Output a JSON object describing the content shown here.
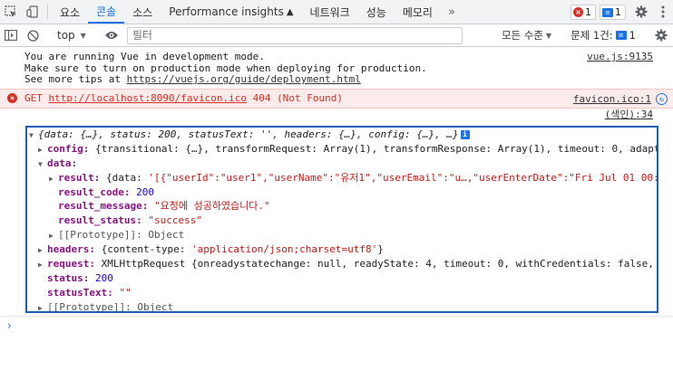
{
  "tabbar": {
    "tabs": [
      {
        "label": "요소"
      },
      {
        "label": "콘솔"
      },
      {
        "label": "소스"
      },
      {
        "label": "Performance insights"
      },
      {
        "label": "네트워크"
      },
      {
        "label": "성능"
      },
      {
        "label": "메모리"
      }
    ],
    "more": "»",
    "error_count": "1",
    "message_count": "1"
  },
  "filterbar": {
    "context": "top",
    "filter_placeholder": "필터",
    "levels": "모든 수준",
    "issues_label": "문제 1건:",
    "issues_count": "1"
  },
  "console": {
    "vue_message": [
      "You are running Vue in development mode.",
      "Make sure to turn on production mode when deploying for production.",
      "See more tips at "
    ],
    "vue_link": "https://vuejs.org/guide/deployment.html",
    "vue_source": "vue.js:9135",
    "error_method": "GET",
    "error_url": "http://localhost:8090/favicon.ico",
    "error_status": "404 (Not Found)",
    "error_source": "favicon.ico:1",
    "index_source": "(색인):34",
    "object": {
      "summary": "{data: {…}, status: 200, statusText: '', headers: {…}, config: {…}, …}",
      "config_key": "config:",
      "config_val": "{transitional: {…}, transformRequest: Array(1), transformResponse: Array(1), timeout: 0, adapt",
      "data_key": "data:",
      "result_key": "result:",
      "result_val_prefix": "{data: ",
      "result_val_str": "'[{\"userId\":\"user1\",\"userName\":\"유저1\",\"userEmail\":\"u…,\"userEnterDate\":\"Fri Jul 01 00:0",
      "result_code_key": "result_code:",
      "result_code_val": "200",
      "result_message_key": "result_message:",
      "result_message_val": "\"요청에 성공하였습니다.\"",
      "result_status_key": "result_status:",
      "result_status_val": "\"success\"",
      "proto_inner": "[[Prototype]]: Object",
      "headers_key": "headers:",
      "headers_val_prefix": "{content-type: ",
      "headers_val_str": "'application/json;charset=utf8'",
      "headers_val_suffix": "}",
      "request_key": "request:",
      "request_val": "XMLHttpRequest {onreadystatechange: null, readyState: 4, timeout: 0, withCredentials: false,",
      "status_key": "status:",
      "status_val": "200",
      "statusText_key": "statusText:",
      "statusText_val": "\"\"",
      "proto_outer": "[[Prototype]]: Object"
    },
    "prompt": "›"
  }
}
